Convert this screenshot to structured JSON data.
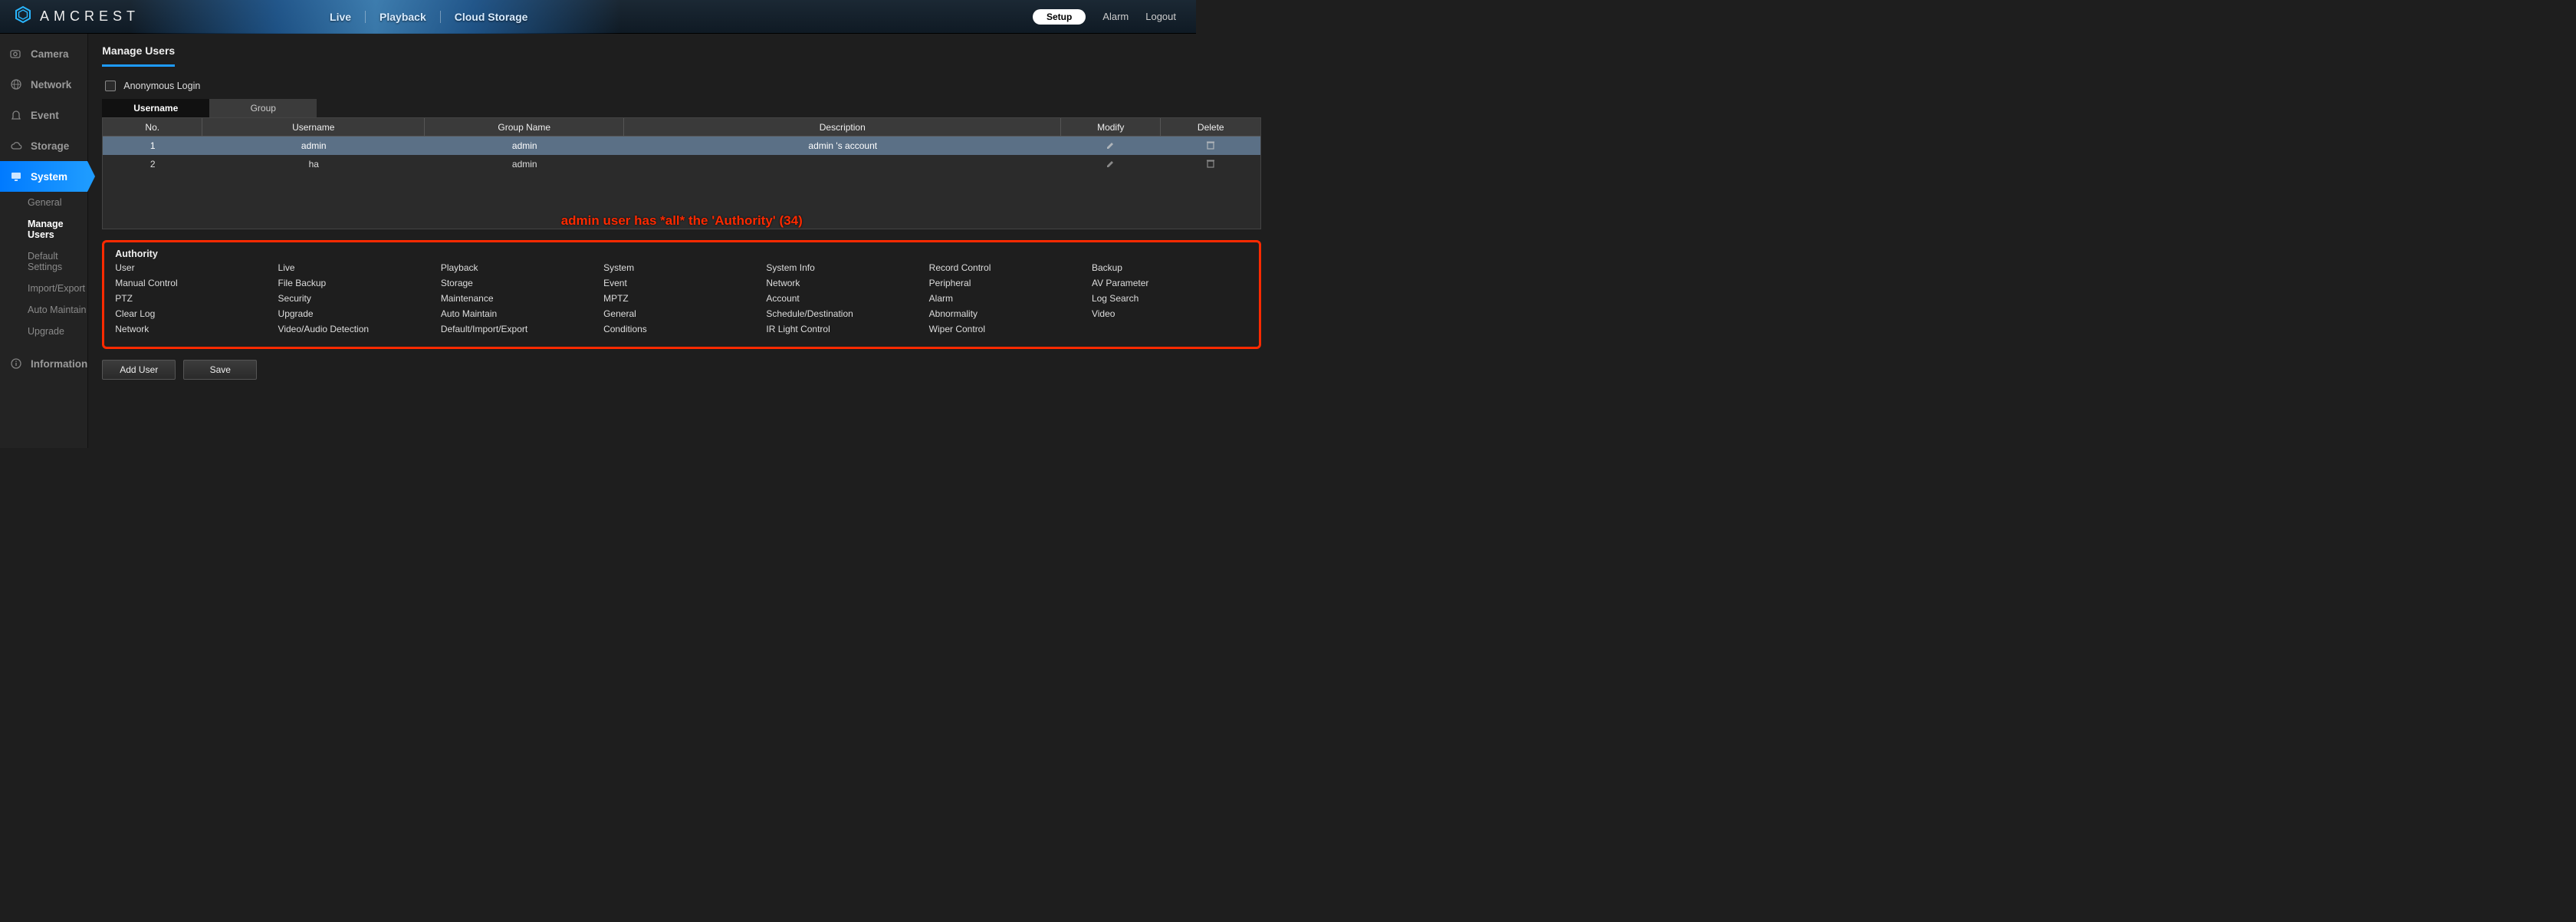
{
  "brand": "AMCREST",
  "topnav": {
    "live": "Live",
    "playback": "Playback",
    "cloud": "Cloud Storage"
  },
  "topright": {
    "setup": "Setup",
    "alarm": "Alarm",
    "logout": "Logout"
  },
  "sidebar": {
    "camera": "Camera",
    "network": "Network",
    "event": "Event",
    "storage": "Storage",
    "system": "System",
    "information": "Information",
    "system_sub": {
      "general": "General",
      "manage_users": "Manage Users",
      "default_settings": "Default Settings",
      "import_export": "Import/Export",
      "auto_maintain": "Auto Maintain",
      "upgrade": "Upgrade"
    }
  },
  "page": {
    "tab": "Manage Users",
    "anon_label": "Anonymous Login",
    "subtabs": {
      "username": "Username",
      "group": "Group"
    }
  },
  "table": {
    "headers": {
      "no": "No.",
      "username": "Username",
      "group": "Group Name",
      "desc": "Description",
      "modify": "Modify",
      "delete": "Delete"
    },
    "rows": [
      {
        "no": "1",
        "username": "admin",
        "group": "admin",
        "desc": "admin 's account"
      },
      {
        "no": "2",
        "username": "ha",
        "group": "admin",
        "desc": ""
      }
    ]
  },
  "authority": {
    "title": "Authority",
    "caption": "admin user has *all* the 'Authority' (34)",
    "items": [
      "User",
      "Live",
      "Playback",
      "System",
      "System Info",
      "Record Control",
      "Backup",
      "Manual Control",
      "File Backup",
      "Storage",
      "Event",
      "Network",
      "Peripheral",
      "AV Parameter",
      "PTZ",
      "Security",
      "Maintenance",
      "MPTZ",
      "Account",
      "Alarm",
      "Log Search",
      "Clear Log",
      "Upgrade",
      "Auto Maintain",
      "General",
      "Schedule/Destination",
      "Abnormality",
      "Video",
      "Network",
      "Video/Audio Detection",
      "Default/Import/Export",
      "Conditions",
      "IR Light Control",
      "Wiper Control"
    ]
  },
  "buttons": {
    "add_user": "Add User",
    "save": "Save"
  }
}
